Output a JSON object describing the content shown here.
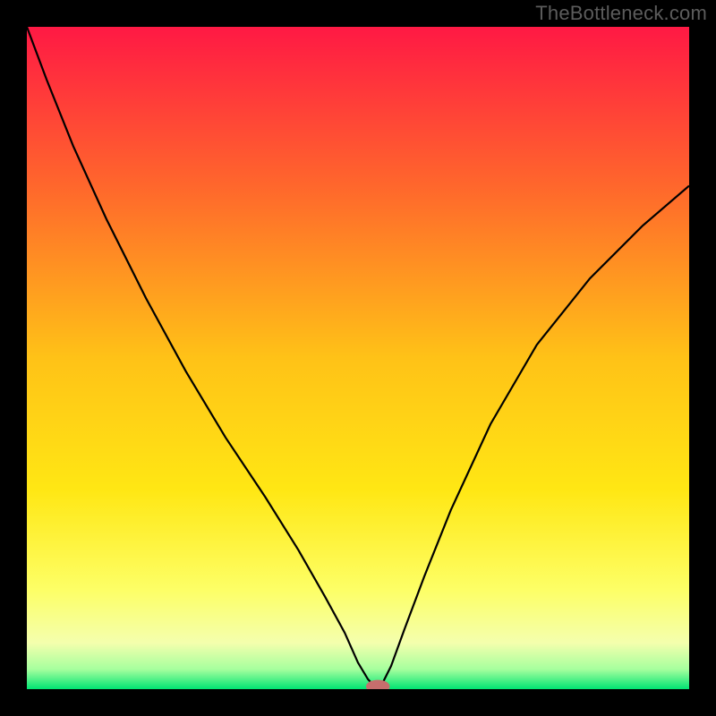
{
  "watermark": "TheBottleneck.com",
  "chart_data": {
    "type": "line",
    "title": "",
    "xlabel": "",
    "ylabel": "",
    "xlim": [
      0,
      100
    ],
    "ylim": [
      0,
      100
    ],
    "grid": false,
    "legend": false,
    "background_gradient_stops": [
      {
        "offset": 0.0,
        "color": "#ff1944"
      },
      {
        "offset": 0.25,
        "color": "#ff6a2b"
      },
      {
        "offset": 0.5,
        "color": "#ffc217"
      },
      {
        "offset": 0.7,
        "color": "#ffe714"
      },
      {
        "offset": 0.85,
        "color": "#fdff66"
      },
      {
        "offset": 0.93,
        "color": "#f4ffad"
      },
      {
        "offset": 0.97,
        "color": "#a6ff9e"
      },
      {
        "offset": 1.0,
        "color": "#00e472"
      }
    ],
    "series": [
      {
        "name": "bottleneck-curve",
        "stroke": "#000000",
        "stroke_width": 2.2,
        "x": [
          0.0,
          3.0,
          7.0,
          12.0,
          18.0,
          24.0,
          30.0,
          36.0,
          41.0,
          45.0,
          48.0,
          50.0,
          51.5,
          52.5,
          53.0,
          53.5,
          55.0,
          57.0,
          60.0,
          64.0,
          70.0,
          77.0,
          85.0,
          93.0,
          100.0
        ],
        "y": [
          100.0,
          92.0,
          82.0,
          71.0,
          59.0,
          48.0,
          38.0,
          29.0,
          21.0,
          14.0,
          8.5,
          4.0,
          1.5,
          0.4,
          0.0,
          0.5,
          3.5,
          9.0,
          17.0,
          27.0,
          40.0,
          52.0,
          62.0,
          70.0,
          76.0
        ]
      }
    ],
    "marker": {
      "name": "optimum-marker",
      "x": 53.0,
      "y": 0.4,
      "rx": 1.8,
      "ry": 1.0,
      "fill": "#c76e6d"
    }
  }
}
